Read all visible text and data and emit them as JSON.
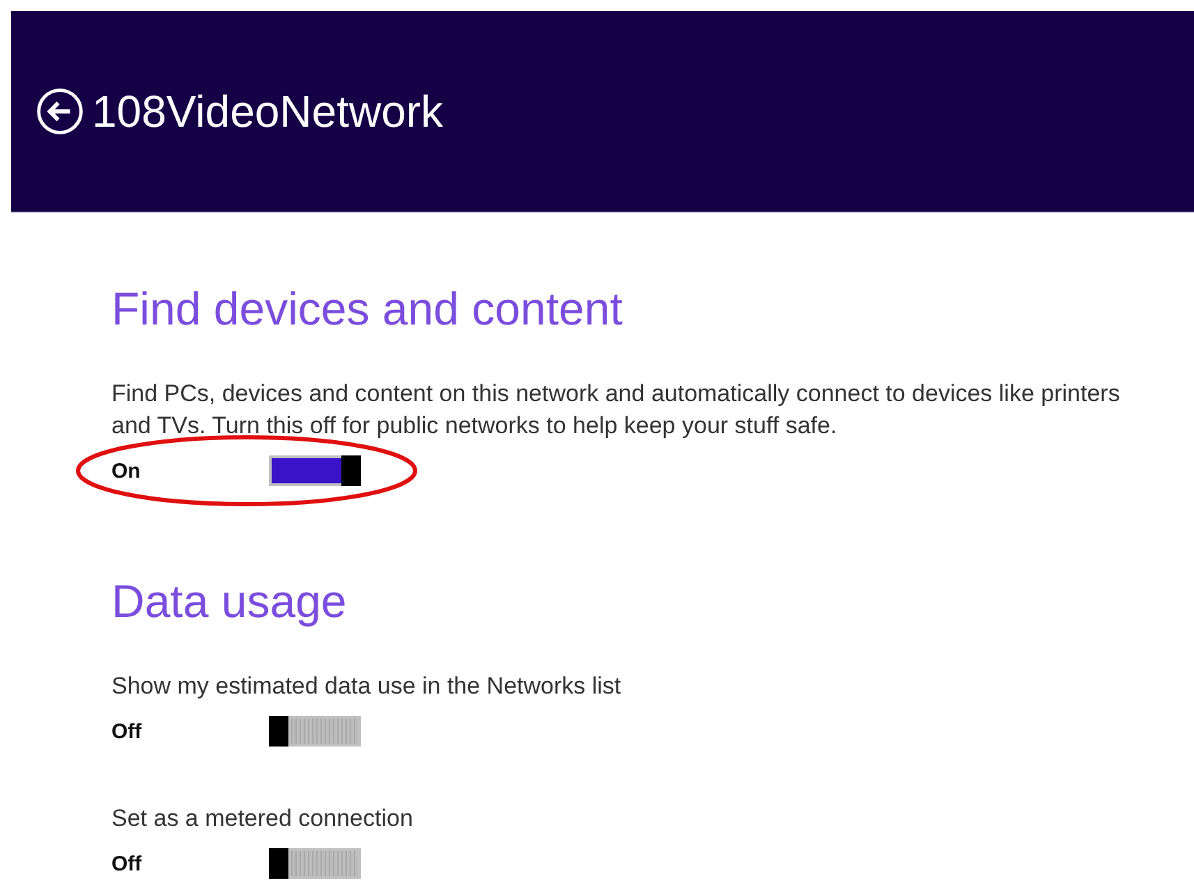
{
  "header": {
    "title": "108VideoNetwork"
  },
  "sections": [
    {
      "title": "Find devices and content",
      "settings": [
        {
          "description": "Find PCs, devices and content on this network and automatically connect to devices like printers and TVs. Turn this off for public networks to help keep your stuff safe.",
          "state_label": "On",
          "on": true,
          "highlighted": true
        }
      ]
    },
    {
      "title": "Data usage",
      "settings": [
        {
          "description": "Show my estimated data use in the Networks list",
          "state_label": "Off",
          "on": false,
          "highlighted": false
        },
        {
          "description": "Set as a metered connection",
          "state_label": "Off",
          "on": false,
          "highlighted": false
        }
      ]
    }
  ]
}
